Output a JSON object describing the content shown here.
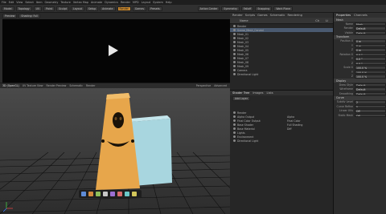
{
  "menu": [
    "File",
    "Edit",
    "View",
    "Select",
    "Item",
    "Geometry",
    "Texture",
    "Vertex Map",
    "Animate",
    "Dynamics",
    "Render",
    "MPD",
    "Layout",
    "System",
    "Help"
  ],
  "toolbar": {
    "left": [
      "Model",
      "Topology",
      "UV",
      "Paint",
      "Sculpt",
      "Layout",
      "Setup",
      "Animate",
      "Render",
      "Games",
      "Presets"
    ],
    "right": [
      "Action Center",
      "Symmetry",
      "Falloff",
      "Snapping",
      "Work Plane"
    ],
    "active": "Render"
  },
  "tabs": [
    "Render",
    "Scripts",
    "Games",
    "Schematic",
    "Rendering"
  ],
  "clip": {
    "label": "Preview",
    "frame": "Shading: Full"
  },
  "viewport": {
    "tabs": [
      "3D (OpenGL)",
      "UV Texture View",
      "Render Preview",
      "Schematic",
      "Render"
    ],
    "mode": "Perspective",
    "shading": "Advanced",
    "info": [
      "Scene",
      "Vertices",
      "Polygons",
      "Edges"
    ]
  },
  "items": {
    "filter": "Items",
    "header": [
      "Name",
      "Ch",
      "Li"
    ],
    "rows": [
      "Render",
      "Scene_Mesh_Carved",
      "Mesh_01",
      "Mesh_02",
      "Mesh_03",
      "Mesh_04",
      "Mesh_05",
      "Mesh_06",
      "Mesh_07",
      "Mesh_08",
      "Mesh_09",
      "Camera",
      "Directional Light"
    ],
    "selected": 1
  },
  "shader": {
    "tabs": [
      "Shader Tree",
      "Images",
      "Lists"
    ],
    "add_layer": "Add Layer",
    "rows": [
      {
        "name": "Render",
        "effect": ""
      },
      {
        "name": "Alpha Output",
        "effect": "Alpha"
      },
      {
        "name": "Final Color Output",
        "effect": "Final Color"
      },
      {
        "name": "Base Shader",
        "effect": "Full Shading"
      },
      {
        "name": "Base Material",
        "effect": "Diff"
      },
      {
        "name": "Lights",
        "effect": ""
      },
      {
        "name": "Environment",
        "effect": ""
      },
      {
        "name": "Directional Light",
        "effect": ""
      }
    ]
  },
  "properties": {
    "tabs": [
      "Properties",
      "Channels"
    ],
    "sections": [
      {
        "title": "Mesh",
        "rows": [
          [
            "Name",
            "Mesh"
          ],
          [
            "Render",
            "Default"
          ],
          [
            "Visible",
            "Default"
          ]
        ]
      },
      {
        "title": "Transform",
        "rows": [
          [
            "Position X",
            "0 m"
          ],
          [
            "Y",
            "0 m"
          ],
          [
            "Z",
            "0 m"
          ],
          [
            "Rotation X",
            "0.0 °"
          ],
          [
            "Y",
            "0.0 °"
          ],
          [
            "Z",
            "0.0 °"
          ],
          [
            "Scale X",
            "100.0 %"
          ],
          [
            "Y",
            "100.0 %"
          ],
          [
            "Z",
            "100.0 %"
          ]
        ]
      },
      {
        "title": "Display",
        "rows": [
          [
            "Draw Style",
            "Default"
          ],
          [
            "Wireframe",
            "Default"
          ],
          [
            "Smoothing",
            "Default"
          ]
        ]
      },
      {
        "title": "Curve",
        "rows": [
          [
            "Subdiv Level",
            "2"
          ],
          [
            "Curve Refine",
            "5"
          ],
          [
            "Linear UVs",
            "Off"
          ],
          [
            "Static Mesh",
            "Off"
          ]
        ]
      }
    ]
  },
  "colors": {
    "accent": "#c7872e",
    "idol": "#e7a64b",
    "box": "#a8d6df",
    "grid": "#101010",
    "video": "#050505"
  }
}
